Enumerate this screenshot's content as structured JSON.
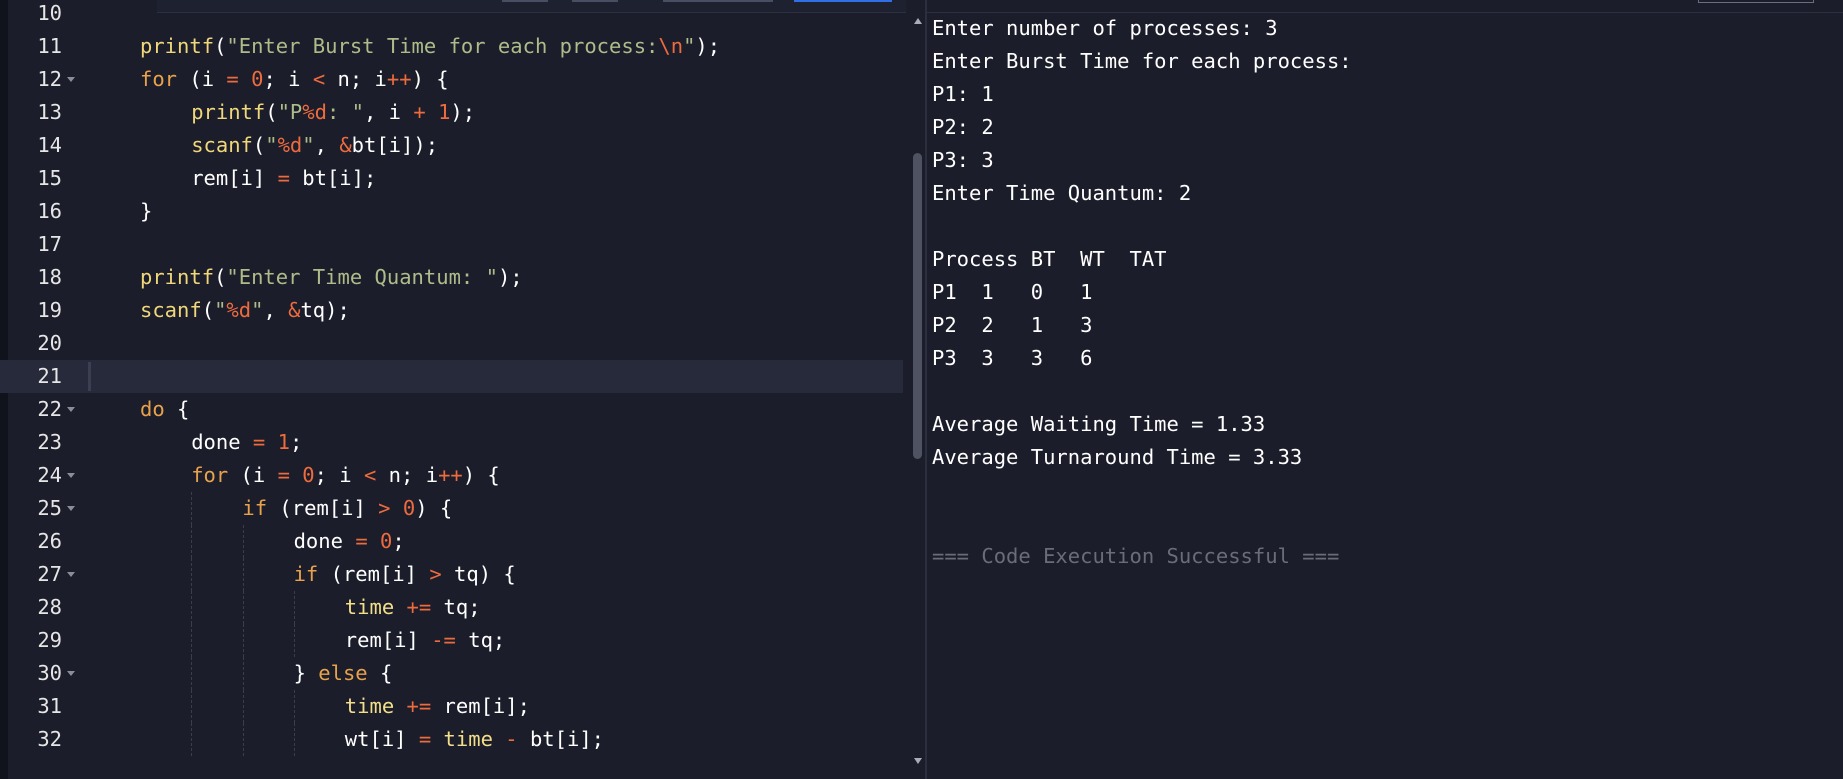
{
  "editor": {
    "lines": [
      {
        "num": "10",
        "fold": false,
        "indent": 0,
        "tokens": []
      },
      {
        "num": "11",
        "fold": false,
        "indent": 1,
        "tokens": [
          {
            "t": "fn",
            "v": "printf"
          },
          {
            "t": "txt",
            "v": "("
          },
          {
            "t": "str",
            "v": "\"Enter Burst Time for each process:"
          },
          {
            "t": "esc",
            "v": "\\n"
          },
          {
            "t": "str",
            "v": "\""
          },
          {
            "t": "txt",
            "v": ");"
          }
        ]
      },
      {
        "num": "12",
        "fold": true,
        "indent": 1,
        "tokens": [
          {
            "t": "kw",
            "v": "for"
          },
          {
            "t": "txt",
            "v": " (i "
          },
          {
            "t": "op",
            "v": "="
          },
          {
            "t": "txt",
            "v": " "
          },
          {
            "t": "num",
            "v": "0"
          },
          {
            "t": "txt",
            "v": "; i "
          },
          {
            "t": "op",
            "v": "<"
          },
          {
            "t": "txt",
            "v": " n; i"
          },
          {
            "t": "op",
            "v": "++"
          },
          {
            "t": "txt",
            "v": ") {"
          }
        ]
      },
      {
        "num": "13",
        "fold": false,
        "indent": 2,
        "tokens": [
          {
            "t": "fn",
            "v": "printf"
          },
          {
            "t": "txt",
            "v": "("
          },
          {
            "t": "str",
            "v": "\"P"
          },
          {
            "t": "esc",
            "v": "%d"
          },
          {
            "t": "str",
            "v": ": \""
          },
          {
            "t": "txt",
            "v": ", i "
          },
          {
            "t": "op",
            "v": "+"
          },
          {
            "t": "txt",
            "v": " "
          },
          {
            "t": "num",
            "v": "1"
          },
          {
            "t": "txt",
            "v": ");"
          }
        ]
      },
      {
        "num": "14",
        "fold": false,
        "indent": 2,
        "tokens": [
          {
            "t": "fn",
            "v": "scanf"
          },
          {
            "t": "txt",
            "v": "("
          },
          {
            "t": "str",
            "v": "\""
          },
          {
            "t": "esc",
            "v": "%d"
          },
          {
            "t": "str",
            "v": "\""
          },
          {
            "t": "txt",
            "v": ", "
          },
          {
            "t": "op",
            "v": "&"
          },
          {
            "t": "txt",
            "v": "bt[i]);"
          }
        ]
      },
      {
        "num": "15",
        "fold": false,
        "indent": 2,
        "tokens": [
          {
            "t": "txt",
            "v": "rem[i] "
          },
          {
            "t": "op",
            "v": "="
          },
          {
            "t": "txt",
            "v": " bt[i];"
          }
        ]
      },
      {
        "num": "16",
        "fold": false,
        "indent": 1,
        "tokens": [
          {
            "t": "txt",
            "v": "}"
          }
        ]
      },
      {
        "num": "17",
        "fold": false,
        "indent": 0,
        "tokens": []
      },
      {
        "num": "18",
        "fold": false,
        "indent": 1,
        "tokens": [
          {
            "t": "fn",
            "v": "printf"
          },
          {
            "t": "txt",
            "v": "("
          },
          {
            "t": "str",
            "v": "\"Enter Time Quantum: \""
          },
          {
            "t": "txt",
            "v": ");"
          }
        ]
      },
      {
        "num": "19",
        "fold": false,
        "indent": 1,
        "tokens": [
          {
            "t": "fn",
            "v": "scanf"
          },
          {
            "t": "txt",
            "v": "("
          },
          {
            "t": "str",
            "v": "\""
          },
          {
            "t": "esc",
            "v": "%d"
          },
          {
            "t": "str",
            "v": "\""
          },
          {
            "t": "txt",
            "v": ", "
          },
          {
            "t": "op",
            "v": "&"
          },
          {
            "t": "txt",
            "v": "tq);"
          }
        ]
      },
      {
        "num": "20",
        "fold": false,
        "indent": 0,
        "tokens": []
      },
      {
        "num": "21",
        "fold": false,
        "indent": 0,
        "active": true,
        "tokens": []
      },
      {
        "num": "22",
        "fold": true,
        "indent": 1,
        "tokens": [
          {
            "t": "kw",
            "v": "do"
          },
          {
            "t": "txt",
            "v": " {"
          }
        ]
      },
      {
        "num": "23",
        "fold": false,
        "indent": 2,
        "tokens": [
          {
            "t": "txt",
            "v": "done "
          },
          {
            "t": "op",
            "v": "="
          },
          {
            "t": "txt",
            "v": " "
          },
          {
            "t": "num",
            "v": "1"
          },
          {
            "t": "txt",
            "v": ";"
          }
        ]
      },
      {
        "num": "24",
        "fold": true,
        "indent": 2,
        "tokens": [
          {
            "t": "kw",
            "v": "for"
          },
          {
            "t": "txt",
            "v": " (i "
          },
          {
            "t": "op",
            "v": "="
          },
          {
            "t": "txt",
            "v": " "
          },
          {
            "t": "num",
            "v": "0"
          },
          {
            "t": "txt",
            "v": "; i "
          },
          {
            "t": "op",
            "v": "<"
          },
          {
            "t": "txt",
            "v": " n; i"
          },
          {
            "t": "op",
            "v": "++"
          },
          {
            "t": "txt",
            "v": ") {"
          }
        ]
      },
      {
        "num": "25",
        "fold": true,
        "indent": 3,
        "tokens": [
          {
            "t": "kw",
            "v": "if"
          },
          {
            "t": "txt",
            "v": " (rem[i] "
          },
          {
            "t": "op",
            "v": ">"
          },
          {
            "t": "txt",
            "v": " "
          },
          {
            "t": "num",
            "v": "0"
          },
          {
            "t": "txt",
            "v": ") {"
          }
        ]
      },
      {
        "num": "26",
        "fold": false,
        "indent": 4,
        "tokens": [
          {
            "t": "txt",
            "v": "done "
          },
          {
            "t": "op",
            "v": "="
          },
          {
            "t": "txt",
            "v": " "
          },
          {
            "t": "num",
            "v": "0"
          },
          {
            "t": "txt",
            "v": ";"
          }
        ]
      },
      {
        "num": "27",
        "fold": true,
        "indent": 4,
        "tokens": [
          {
            "t": "kw",
            "v": "if"
          },
          {
            "t": "txt",
            "v": " (rem[i] "
          },
          {
            "t": "op",
            "v": ">"
          },
          {
            "t": "txt",
            "v": " tq) {"
          }
        ]
      },
      {
        "num": "28",
        "fold": false,
        "indent": 5,
        "tokens": [
          {
            "t": "var",
            "v": "time"
          },
          {
            "t": "txt",
            "v": " "
          },
          {
            "t": "op",
            "v": "+="
          },
          {
            "t": "txt",
            "v": " tq;"
          }
        ]
      },
      {
        "num": "29",
        "fold": false,
        "indent": 5,
        "tokens": [
          {
            "t": "txt",
            "v": "rem[i] "
          },
          {
            "t": "op",
            "v": "-="
          },
          {
            "t": "txt",
            "v": " tq;"
          }
        ]
      },
      {
        "num": "30",
        "fold": true,
        "indent": 4,
        "tokens": [
          {
            "t": "txt",
            "v": "} "
          },
          {
            "t": "kw",
            "v": "else"
          },
          {
            "t": "txt",
            "v": " {"
          }
        ]
      },
      {
        "num": "31",
        "fold": false,
        "indent": 5,
        "tokens": [
          {
            "t": "var",
            "v": "time"
          },
          {
            "t": "txt",
            "v": " "
          },
          {
            "t": "op",
            "v": "+="
          },
          {
            "t": "txt",
            "v": " rem[i];"
          }
        ]
      },
      {
        "num": "32",
        "fold": false,
        "indent": 5,
        "tokens": [
          {
            "t": "txt",
            "v": "wt[i] "
          },
          {
            "t": "op",
            "v": "="
          },
          {
            "t": "txt",
            "v": " "
          },
          {
            "t": "var",
            "v": "time"
          },
          {
            "t": "txt",
            "v": " "
          },
          {
            "t": "op",
            "v": "-"
          },
          {
            "t": "txt",
            "v": " bt[i];"
          }
        ]
      }
    ]
  },
  "output": {
    "lines": [
      "Enter number of processes: 3",
      "Enter Burst Time for each process:",
      "P1: 1",
      "P2: 2",
      "P3: 3",
      "Enter Time Quantum: 2",
      "",
      "Process BT  WT  TAT",
      "P1  1   0   1",
      "P2  2   1   3",
      "P3  3   3   6",
      "",
      "Average Waiting Time = 1.33",
      "Average Turnaround Time = 3.33"
    ],
    "success_message": "=== Code Execution Successful ==="
  }
}
